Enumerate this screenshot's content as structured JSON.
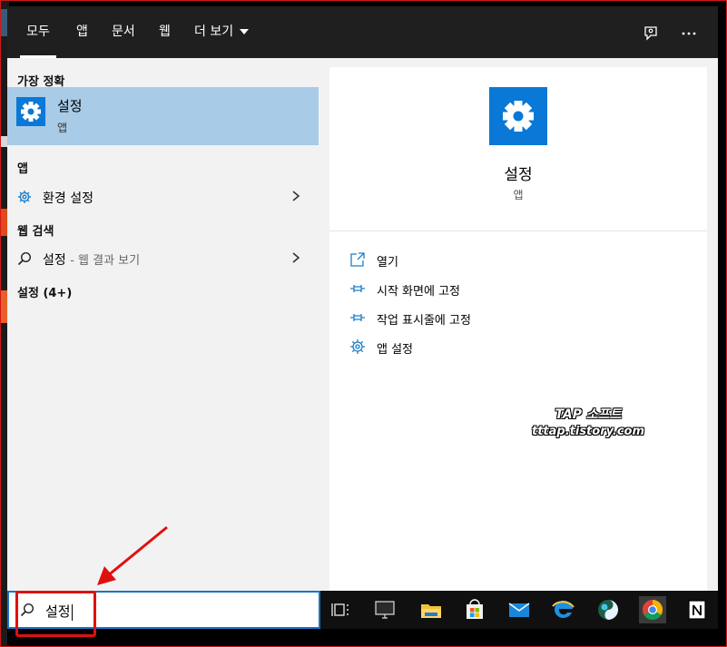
{
  "tabs": [
    {
      "label": "모두",
      "active": true
    },
    {
      "label": "앱"
    },
    {
      "label": "문서"
    },
    {
      "label": "웹"
    },
    {
      "label": "더 보기"
    }
  ],
  "top_icons": [
    "feedback-icon",
    "more-icon"
  ],
  "left": {
    "best_match_header": "가장 정확",
    "best_match": {
      "name": "설정",
      "type": "앱",
      "icon": "gear-icon"
    },
    "apps_header": "앱",
    "apps": [
      {
        "label": "환경 설정",
        "icon": "gear-outline-icon"
      }
    ],
    "web_header": "웹 검색",
    "web": {
      "query": "설정",
      "suffix": "- 웹 결과 보기",
      "icon": "search-icon"
    },
    "settings_header": "설정 (4+)"
  },
  "right": {
    "title": "설정",
    "subtitle": "앱",
    "actions": [
      {
        "label": "열기",
        "icon": "open-icon"
      },
      {
        "label": "시작 화면에 고정",
        "icon": "pin-icon"
      },
      {
        "label": "작업 표시줄에 고정",
        "icon": "pin-icon"
      },
      {
        "label": "앱 설정",
        "icon": "gear-outline-icon"
      }
    ],
    "watermark": {
      "line1": "TAP 소프트",
      "line2": "tttap.tistory.com"
    }
  },
  "search": {
    "value": "설정",
    "icon": "search-icon"
  },
  "taskbar_icons": [
    "task-view-icon",
    "monitor-icon",
    "file-explorer-icon",
    "store-icon",
    "mail-icon",
    "edge-icon",
    "app-icon",
    "chrome-icon",
    "notion-icon"
  ],
  "colors": {
    "accent": "#0a78d6",
    "selected": "#a8cbe7",
    "highlight": "#e01010",
    "topbar": "#1f1f1f"
  }
}
